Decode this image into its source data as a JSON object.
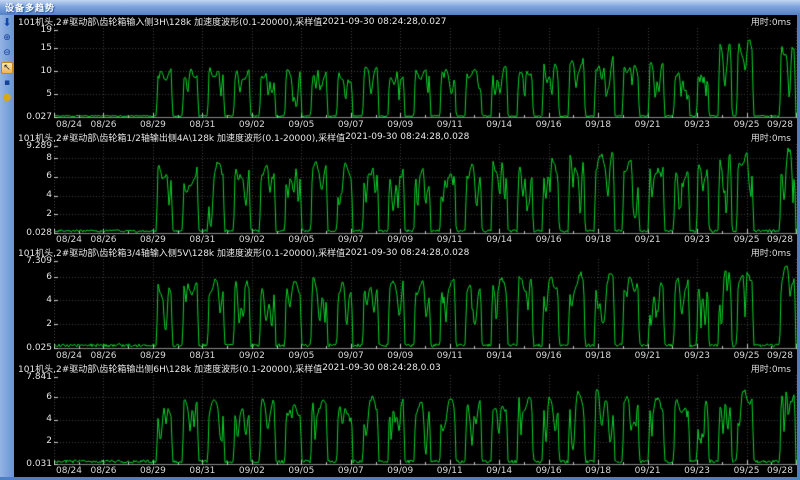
{
  "window": {
    "title": "设备多趋势"
  },
  "toolbar": {
    "icons": [
      {
        "name": "scroll-down-icon",
        "glyph": "⬇"
      },
      {
        "name": "zoom-in-icon",
        "glyph": "⊕"
      },
      {
        "name": "zoom-out-icon",
        "glyph": "⊖"
      },
      {
        "name": "cursor-tool-icon",
        "glyph": "↖",
        "selected": true
      },
      {
        "name": "marker-icon",
        "glyph": "▪"
      },
      {
        "name": "data-ball-icon",
        "glyph": "●"
      }
    ]
  },
  "colors": {
    "trace": "#0bd32b",
    "grid": "#3d3d3d",
    "axis": "#8a8a8a",
    "tick": "#c8c8c8",
    "plot_bg": "#000000",
    "titlebar": "#6b93d4",
    "tool_highlight": "#f3b156"
  },
  "chart_data": {
    "type": "line",
    "legend_position": "none",
    "grid": "dotted",
    "x_labels": [
      "08/24",
      "08/26",
      "08/29",
      "08/31",
      "09/02",
      "09/05",
      "09/07",
      "09/09",
      "09/11",
      "09/14",
      "09/16",
      "09/18",
      "09/21",
      "09/23",
      "09/25",
      "09/28"
    ],
    "x_range": [
      "08/24",
      "09/28"
    ],
    "charts": [
      {
        "title": "101机头,2#驱动部\\齿轮箱输入侧3H\\128k 加速度波形(0.1-20000),采样值",
        "timestamp": "2021-09-30 08:24:28,0.027",
        "duration": "用时:0ms",
        "ylim": 19,
        "y_top_label": "19",
        "y_bottom_label": "0.027",
        "yticks": [
          15,
          10,
          5
        ],
        "bursts": [
          [
            0.138,
            0.16,
            10.3
          ],
          [
            0.173,
            0.195,
            10.6
          ],
          [
            0.207,
            0.23,
            10.9
          ],
          [
            0.242,
            0.265,
            10.4
          ],
          [
            0.277,
            0.299,
            10.7
          ],
          [
            0.311,
            0.334,
            10.5
          ],
          [
            0.346,
            0.369,
            10.9
          ],
          [
            0.381,
            0.403,
            10.6
          ],
          [
            0.416,
            0.438,
            11.0
          ],
          [
            0.45,
            0.473,
            10.7
          ],
          [
            0.485,
            0.508,
            10.5
          ],
          [
            0.52,
            0.542,
            10.9
          ],
          [
            0.554,
            0.577,
            10.6
          ],
          [
            0.589,
            0.612,
            11.0
          ],
          [
            0.624,
            0.646,
            11.3
          ],
          [
            0.658,
            0.681,
            12.0
          ],
          [
            0.693,
            0.716,
            12.7
          ],
          [
            0.728,
            0.756,
            13.2
          ],
          [
            0.766,
            0.789,
            12.3
          ],
          [
            0.801,
            0.823,
            11.7
          ],
          [
            0.835,
            0.857,
            11.3
          ],
          [
            0.866,
            0.883,
            10.9
          ],
          [
            0.895,
            0.914,
            16.2
          ],
          [
            0.92,
            0.943,
            16.6
          ],
          [
            0.978,
            1.0,
            17.0
          ]
        ]
      },
      {
        "title": "101机头,2#驱动部\\齿轮箱1/2轴输出侧4A\\128k 加速度波形(0.1-20000),采样值",
        "timestamp": "2021-09-30 08:24:28,0.028",
        "duration": "用时:0ms",
        "ylim": 9.289,
        "y_top_label": "9.289",
        "y_bottom_label": "0.028",
        "yticks": [
          8,
          6,
          4,
          2
        ],
        "bursts": [
          [
            0.138,
            0.16,
            7.2
          ],
          [
            0.173,
            0.195,
            7.4
          ],
          [
            0.207,
            0.23,
            7.6
          ],
          [
            0.242,
            0.265,
            7.3
          ],
          [
            0.277,
            0.299,
            7.5
          ],
          [
            0.311,
            0.334,
            7.3
          ],
          [
            0.346,
            0.369,
            7.6
          ],
          [
            0.381,
            0.403,
            7.4
          ],
          [
            0.416,
            0.438,
            7.7
          ],
          [
            0.45,
            0.473,
            7.5
          ],
          [
            0.485,
            0.508,
            7.3
          ],
          [
            0.52,
            0.542,
            7.6
          ],
          [
            0.554,
            0.577,
            7.4
          ],
          [
            0.589,
            0.612,
            7.7
          ],
          [
            0.624,
            0.646,
            7.8
          ],
          [
            0.658,
            0.681,
            8.0
          ],
          [
            0.693,
            0.716,
            8.2
          ],
          [
            0.728,
            0.756,
            8.4
          ],
          [
            0.766,
            0.789,
            8.0
          ],
          [
            0.801,
            0.823,
            7.8
          ],
          [
            0.835,
            0.857,
            7.6
          ],
          [
            0.866,
            0.883,
            7.4
          ],
          [
            0.895,
            0.914,
            8.6
          ],
          [
            0.92,
            0.943,
            8.8
          ],
          [
            0.978,
            1.0,
            9.0
          ]
        ]
      },
      {
        "title": "101机头,2#驱动部\\齿轮箱3/4轴输入侧5V\\128k 加速度波形(0.1-20000),采样值",
        "timestamp": "2021-09-30 08:24:28,0.028",
        "duration": "用时:0ms",
        "ylim": 7.309,
        "y_top_label": "7.309",
        "y_bottom_label": "0.025",
        "yticks": [
          6,
          4,
          2
        ],
        "bursts": [
          [
            0.138,
            0.16,
            5.5
          ],
          [
            0.173,
            0.195,
            5.7
          ],
          [
            0.207,
            0.23,
            5.8
          ],
          [
            0.242,
            0.265,
            5.6
          ],
          [
            0.277,
            0.299,
            5.7
          ],
          [
            0.311,
            0.334,
            5.6
          ],
          [
            0.346,
            0.369,
            5.8
          ],
          [
            0.381,
            0.403,
            5.7
          ],
          [
            0.416,
            0.438,
            5.9
          ],
          [
            0.45,
            0.473,
            5.7
          ],
          [
            0.485,
            0.508,
            5.6
          ],
          [
            0.52,
            0.542,
            5.8
          ],
          [
            0.554,
            0.577,
            5.7
          ],
          [
            0.589,
            0.612,
            5.9
          ],
          [
            0.624,
            0.646,
            6.0
          ],
          [
            0.658,
            0.681,
            6.1
          ],
          [
            0.693,
            0.716,
            6.3
          ],
          [
            0.728,
            0.756,
            6.4
          ],
          [
            0.766,
            0.789,
            6.1
          ],
          [
            0.801,
            0.823,
            5.9
          ],
          [
            0.835,
            0.857,
            5.8
          ],
          [
            0.866,
            0.883,
            5.6
          ],
          [
            0.895,
            0.914,
            6.8
          ],
          [
            0.92,
            0.943,
            7.0
          ],
          [
            0.978,
            1.0,
            7.1
          ]
        ]
      },
      {
        "title": "101机头,2#驱动部\\齿轮箱输出侧6H\\128k 加速度波形(0.1-20000),采样值",
        "timestamp": "2021-09-30 08:24:28,0.03",
        "duration": "用时:0ms",
        "ylim": 7.841,
        "y_top_label": "7.841",
        "y_bottom_label": "0.031",
        "yticks": [
          6,
          4,
          2
        ],
        "bursts": [
          [
            0.138,
            0.16,
            5.5
          ],
          [
            0.173,
            0.195,
            5.7
          ],
          [
            0.207,
            0.23,
            5.9
          ],
          [
            0.242,
            0.265,
            5.6
          ],
          [
            0.277,
            0.299,
            5.8
          ],
          [
            0.311,
            0.334,
            5.6
          ],
          [
            0.346,
            0.369,
            5.9
          ],
          [
            0.381,
            0.403,
            5.7
          ],
          [
            0.416,
            0.438,
            6.0
          ],
          [
            0.45,
            0.473,
            5.8
          ],
          [
            0.485,
            0.508,
            5.6
          ],
          [
            0.52,
            0.542,
            5.9
          ],
          [
            0.554,
            0.577,
            5.7
          ],
          [
            0.589,
            0.612,
            6.0
          ],
          [
            0.624,
            0.646,
            6.1
          ],
          [
            0.658,
            0.681,
            6.3
          ],
          [
            0.693,
            0.716,
            6.5
          ],
          [
            0.728,
            0.756,
            6.6
          ],
          [
            0.766,
            0.789,
            6.2
          ],
          [
            0.801,
            0.823,
            6.0
          ],
          [
            0.835,
            0.857,
            5.8
          ],
          [
            0.866,
            0.883,
            5.6
          ],
          [
            0.895,
            0.914,
            6.5
          ],
          [
            0.92,
            0.943,
            6.8
          ],
          [
            0.978,
            1.0,
            7.0
          ]
        ]
      }
    ]
  }
}
